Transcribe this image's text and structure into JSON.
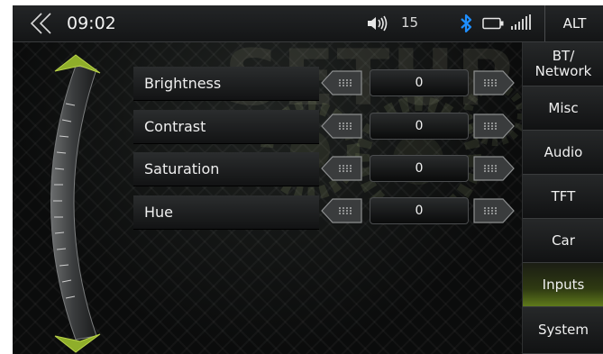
{
  "status_bar": {
    "time": "09:02",
    "volume_level": "15",
    "alt_label": "ALT"
  },
  "watermark": "SETUP",
  "settings": [
    {
      "label": "Brightness",
      "value": "0"
    },
    {
      "label": "Contrast",
      "value": "0"
    },
    {
      "label": "Saturation",
      "value": "0"
    },
    {
      "label": "Hue",
      "value": "0"
    }
  ],
  "nav": {
    "items": [
      {
        "label": "BT/\nNetwork"
      },
      {
        "label": "Misc"
      },
      {
        "label": "Audio"
      },
      {
        "label": "TFT"
      },
      {
        "label": "Car"
      },
      {
        "label": "Inputs",
        "active": true
      },
      {
        "label": "System"
      }
    ]
  },
  "colors": {
    "accent": "#8fae2a",
    "bluetooth": "#1e8fff",
    "background": "#050606",
    "text": "#f0f0f0"
  },
  "icons": [
    "back-double-chevron-icon",
    "volume-icon",
    "bluetooth-icon",
    "battery-icon",
    "signal-icon",
    "left-arrow-icon",
    "right-arrow-icon"
  ]
}
